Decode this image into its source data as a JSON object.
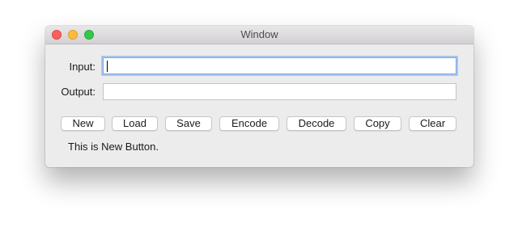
{
  "window": {
    "title": "Window"
  },
  "form": {
    "input_label": "Input:",
    "input_value": "",
    "output_label": "Output:",
    "output_value": ""
  },
  "buttons": {
    "new": "New",
    "load": "Load",
    "save": "Save",
    "encode": "Encode",
    "decode": "Decode",
    "copy": "Copy",
    "clear": "Clear"
  },
  "status_text": "This is New Button.",
  "colors": {
    "close": "#fc605c",
    "minimize": "#fdbc40",
    "maximize": "#34c84a",
    "focus_ring": "#a8c6f1"
  }
}
